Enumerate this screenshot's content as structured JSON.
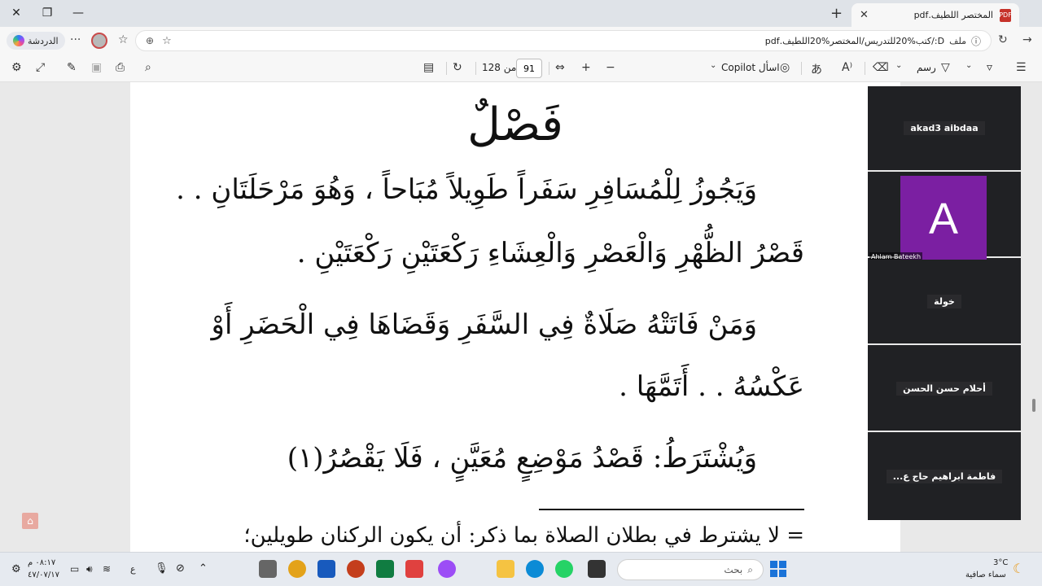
{
  "browser": {
    "tab_title": "المختصر اللطيف.pdf",
    "tab_icon": "pdf-icon",
    "chat_label": "الدردشة",
    "address_label": "ملف",
    "address_url": "D:/كتب%20للتدريس/المختصر%20اللطيف.pdf"
  },
  "pdf_toolbar": {
    "page_current": "91",
    "page_of": "من 128",
    "copilot_label": "اسأل Copilot",
    "draw_label": "رسم",
    "zoom_in": "+",
    "zoom_out": "−"
  },
  "document": {
    "heading": "فَصْلٌ",
    "lines": [
      "وَيَجُوزُ لِلْمُسَافِرِ سَفَراً طَوِيلاً مُبَاحاً ، وَهُوَ مَرْحَلَتَانِ . .",
      "قَصْرُ الظُّهْرِ وَالْعَصْرِ وَالْعِشَاءِ رَكْعَتَيْنِ رَكْعَتَيْنِ .",
      "وَمَنْ فَاتَتْهُ صَلَاةٌ فِي السَّفَرِ وَقَضَاهَا فِي الْحَضَرِ أَوْ",
      "عَكْسُهُ . . أَتَمَّهَا .",
      "وَيُشْتَرَطُ: قَصْدُ مَوْضِعٍ مُعَيَّنٍ ، فَلَا يَقْصُرُ(١)"
    ],
    "footnote": "=   لا يشترط في بطلان الصلاة بما ذكر: أن يكون الركنان طويلين؛"
  },
  "participants": [
    {
      "name": "akad3 aibdaa",
      "type": "name"
    },
    {
      "name": "Ahlam Bateekh",
      "initial": "A",
      "color": "#7b1fa2",
      "type": "avatar"
    },
    {
      "name": "خولة",
      "type": "name"
    },
    {
      "name": "أحلام حسن الحسن",
      "type": "name"
    },
    {
      "name": "فاطمة ابراهيم حاج ع...",
      "type": "name"
    }
  ],
  "taskbar": {
    "weather_temp": "3°C",
    "weather_desc": "سماء صافية",
    "search_placeholder": "بحث",
    "time": "٠٨:١٧ م",
    "date": "٤٧/٠٧/١٧",
    "lang": "ع"
  }
}
